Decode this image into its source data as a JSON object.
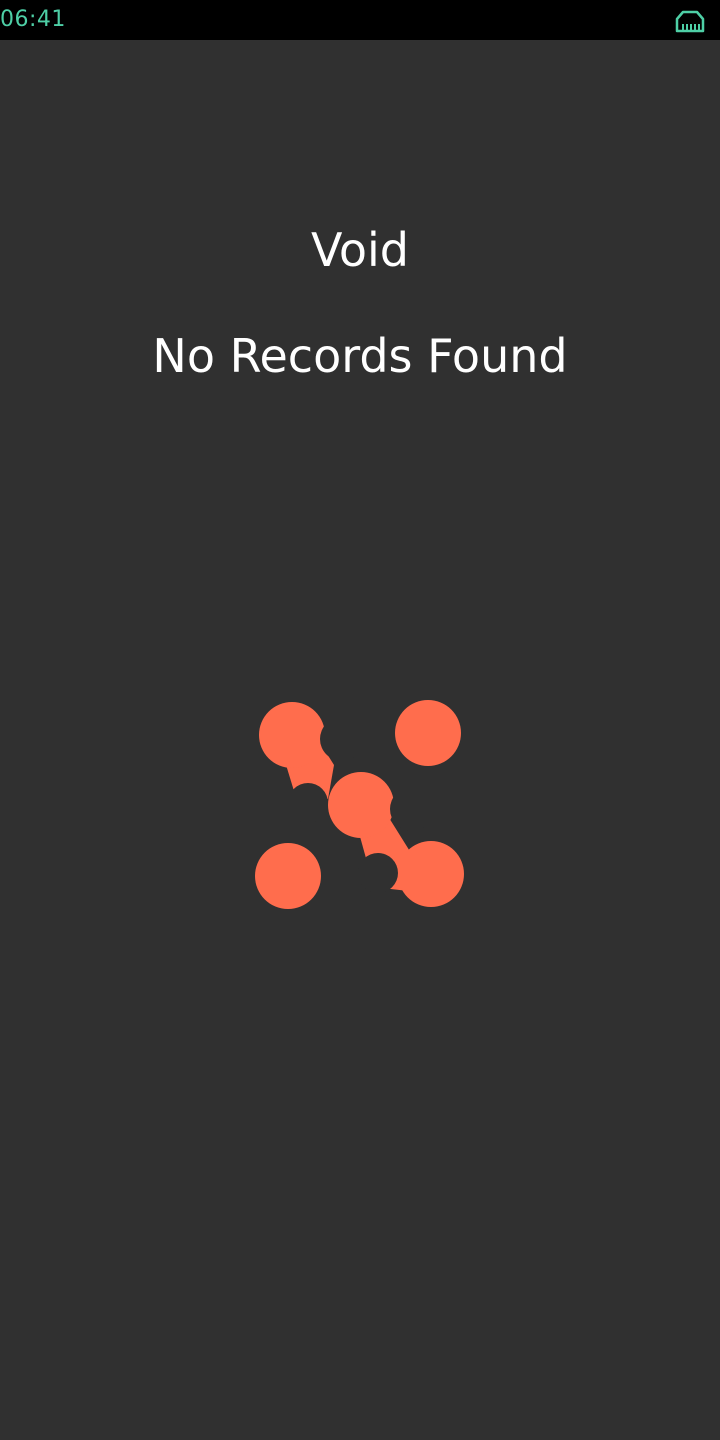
{
  "status_bar": {
    "time": "06:41",
    "network_icon": "ethernet-icon",
    "time_color": "#4ecfa6"
  },
  "screen": {
    "title": "Void",
    "message": "No Records Found",
    "logo_icon": "app-logo-icon",
    "logo_color": "#ff6d4d",
    "background": "#303030"
  }
}
